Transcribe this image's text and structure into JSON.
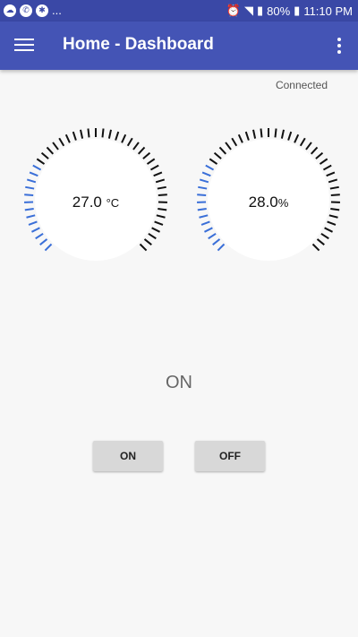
{
  "status_bar": {
    "ellipsis": "...",
    "battery": "80%",
    "time": "11:10 PM"
  },
  "app_bar": {
    "title": "Home - Dashboard"
  },
  "connection": {
    "status": "Connected"
  },
  "gauges": [
    {
      "value": "27.0",
      "unit": "°C",
      "fill_fraction": 0.28
    },
    {
      "value": "28.0",
      "unit": "%",
      "fill_fraction": 0.28
    }
  ],
  "colors": {
    "status_bar": "#3a48a6",
    "app_bar": "#4454b5",
    "gauge_fill": "#3a6fd8",
    "gauge_empty": "#111111"
  },
  "device": {
    "state": "ON"
  },
  "controls": {
    "on_label": "ON",
    "off_label": "OFF"
  }
}
